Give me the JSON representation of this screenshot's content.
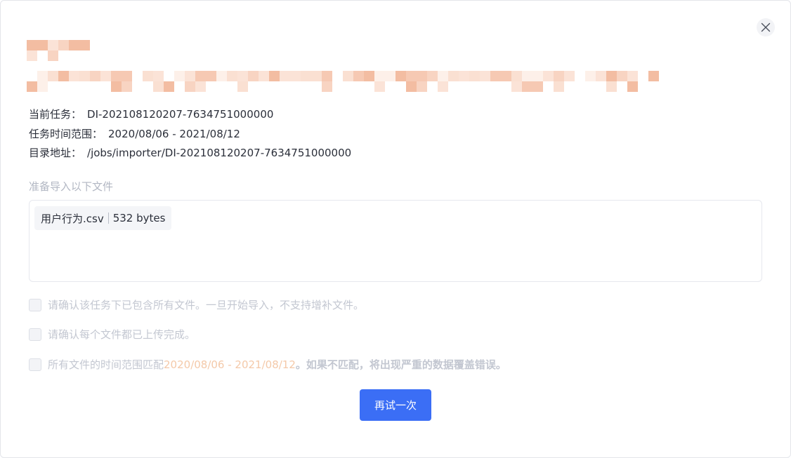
{
  "dialog": {
    "close_icon": "close-icon",
    "task_info": {
      "current_task_label": "当前任务：",
      "current_task_value": "DI-202108120207-7634751000000",
      "time_range_label": "任务时间范围：",
      "time_range_value": "2020/08/06 - 2021/08/12",
      "directory_label": "目录地址：",
      "directory_value": "/jobs/importer/DI-202108120207-7634751000000"
    },
    "files_section": {
      "label": "准备导入以下文件",
      "files": [
        {
          "name": "用户行为.csv",
          "size": "532 bytes"
        }
      ]
    },
    "confirmations": {
      "item1": "请确认该任务下已包含所有文件。一旦开始导入，不支持增补文件。",
      "item2": "请确认每个文件都已上传完成。",
      "item3_prefix": "所有文件的时间范围匹配 ",
      "item3_range": "2020/08/06 - 2021/08/12",
      "item3_suffix": "。如果不匹配，将出现严重的数据覆盖错误。"
    },
    "retry_button": "再试一次",
    "colors": {
      "primary": "#3b6ef5",
      "highlight": "#f4c9a9",
      "redacted": "#f6c9b3"
    }
  }
}
